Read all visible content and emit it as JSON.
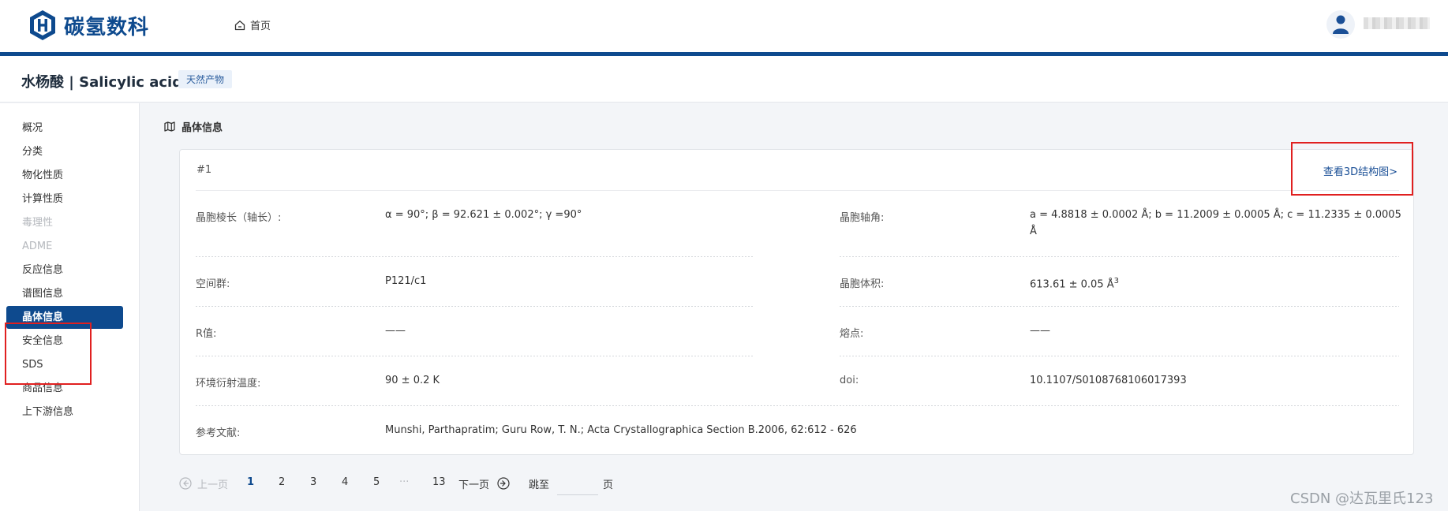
{
  "header": {
    "logo_text": "碳氢数科",
    "logo_icon": "hexagon-h-logo",
    "nav_home": "首页",
    "home_icon": "home-icon",
    "brand_color": "#0e4a8e"
  },
  "title": {
    "compound": "水杨酸 | Salicylic acid",
    "tag": "天然产物"
  },
  "sidebar": {
    "items": [
      {
        "label": "概况",
        "state": "normal"
      },
      {
        "label": "分类",
        "state": "normal"
      },
      {
        "label": "物化性质",
        "state": "normal"
      },
      {
        "label": "计算性质",
        "state": "normal"
      },
      {
        "label": "毒理性",
        "state": "disabled"
      },
      {
        "label": "ADME",
        "state": "disabled"
      },
      {
        "label": "反应信息",
        "state": "normal"
      },
      {
        "label": "谱图信息",
        "state": "normal"
      },
      {
        "label": "晶体信息",
        "state": "active"
      },
      {
        "label": "安全信息",
        "state": "normal"
      },
      {
        "label": "SDS",
        "state": "normal"
      },
      {
        "label": "商品信息",
        "state": "normal"
      },
      {
        "label": "上下游信息",
        "state": "normal"
      }
    ]
  },
  "section": {
    "title": "晶体信息",
    "icon": "map-icon"
  },
  "crystal": {
    "index": "#1",
    "view3d": "查看3D结构图>",
    "fields": {
      "cell_angles_label": "晶胞棱长（轴长）:",
      "cell_angles_value": "α = 90°; β = 92.621 ± 0.002°; γ =90°",
      "cell_axes_label": "晶胞轴角:",
      "cell_axes_value": "a = 4.8818 ± 0.0002 Å; b = 11.2009 ± 0.0005 Å; c = 11.2335 ± 0.0005 Å",
      "space_group_label": "空间群:",
      "space_group_value": "P121/c1",
      "volume_label": "晶胞体积:",
      "volume_value": "613.61 ± 0.05 Å",
      "volume_exponent": "3",
      "r_label": "R值:",
      "r_value": "——",
      "melting_label": "熔点:",
      "melting_value": "——",
      "temp_label": "环境衍射温度:",
      "temp_value": "90 ± 0.2 K",
      "doi_label": "doi:",
      "doi_value": "10.1107/S0108768106017393",
      "ref_label": "参考文献:",
      "ref_value": "Munshi, Parthapratim; Guru Row, T. N.; Acta Crystallographica Section B.2006, 62:612 - 626"
    }
  },
  "pagination": {
    "prev": "上一页",
    "pages": [
      "1",
      "2",
      "3",
      "4",
      "5"
    ],
    "ellipsis": "···",
    "last": "13",
    "next": "下一页",
    "jump_label": "跳至",
    "jump_suffix": "页",
    "current": "1"
  },
  "watermark": "CSDN @达瓦里氏123"
}
